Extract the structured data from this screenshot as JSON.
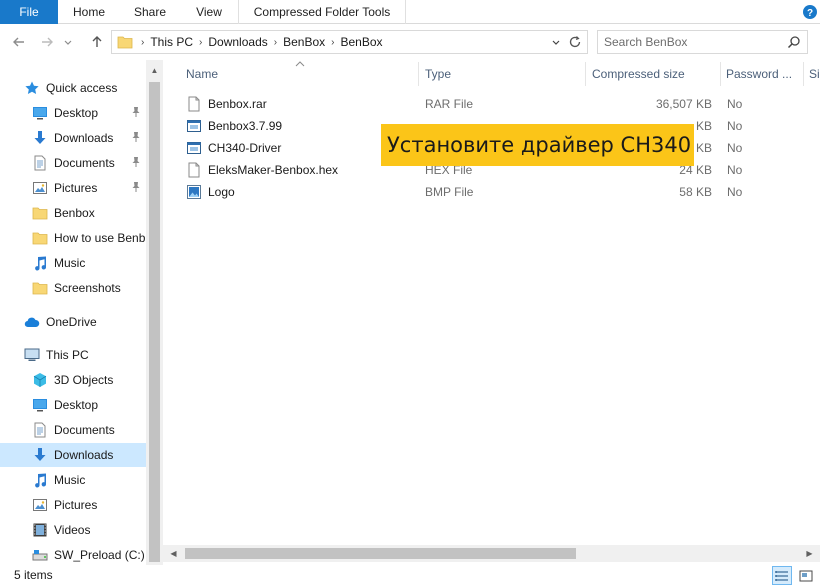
{
  "ribbon": {
    "tabs": [
      {
        "label": "File"
      },
      {
        "label": "Home"
      },
      {
        "label": "Share"
      },
      {
        "label": "View"
      },
      {
        "label": "Compressed Folder Tools"
      }
    ]
  },
  "address": {
    "breadcrumbs": [
      "This PC",
      "Downloads",
      "BenBox",
      "BenBox"
    ]
  },
  "search": {
    "placeholder": "Search BenBox"
  },
  "nav": {
    "items": [
      {
        "label": "Quick access",
        "icon": "star-icon"
      },
      {
        "label": "Desktop",
        "icon": "desktop-icon",
        "pinned": true
      },
      {
        "label": "Downloads",
        "icon": "download-icon",
        "pinned": true
      },
      {
        "label": "Documents",
        "icon": "documents-icon",
        "pinned": true
      },
      {
        "label": "Pictures",
        "icon": "pictures-icon",
        "pinned": true
      },
      {
        "label": "Benbox",
        "icon": "folder-icon"
      },
      {
        "label": "How to use Benb",
        "icon": "folder-icon"
      },
      {
        "label": "Music",
        "icon": "music-icon"
      },
      {
        "label": "Screenshots",
        "icon": "folder-icon"
      },
      {
        "label": "OneDrive",
        "icon": "cloud-icon"
      },
      {
        "label": "This PC",
        "icon": "computer-icon"
      },
      {
        "label": "3D Objects",
        "icon": "cube-icon"
      },
      {
        "label": "Desktop",
        "icon": "desktop-icon"
      },
      {
        "label": "Documents",
        "icon": "documents-icon"
      },
      {
        "label": "Downloads",
        "icon": "download-icon",
        "selected": true
      },
      {
        "label": "Music",
        "icon": "music-icon"
      },
      {
        "label": "Pictures",
        "icon": "pictures-icon"
      },
      {
        "label": "Videos",
        "icon": "video-icon"
      },
      {
        "label": "SW_Preload (C:)",
        "icon": "drive-icon"
      }
    ]
  },
  "columns": {
    "name": "Name",
    "type": "Type",
    "compressed_size": "Compressed size",
    "password": "Password ...",
    "extra": "Si"
  },
  "files": [
    {
      "name": "Benbox.rar",
      "type": "RAR File",
      "size": "36,507 KB",
      "password": "No",
      "icon": "document-icon"
    },
    {
      "name": "Benbox3.7.99",
      "type": "",
      "size": "KB",
      "password": "No",
      "icon": "application-icon"
    },
    {
      "name": "CH340-Driver",
      "type": "",
      "size": "KB",
      "password": "No",
      "icon": "application-icon"
    },
    {
      "name": "EleksMaker-Benbox.hex",
      "type": "HEX File",
      "size": "24 KB",
      "password": "No",
      "icon": "document-icon"
    },
    {
      "name": "Logo",
      "type": "BMP File",
      "size": "58 KB",
      "password": "No",
      "icon": "image-icon"
    }
  ],
  "overlay": {
    "text": "Установите драйвер CH340"
  },
  "status": {
    "items_count": "5 items"
  },
  "colors": {
    "accent": "#1979ca",
    "selected": "#cce8ff",
    "banner": "#fbc518"
  }
}
